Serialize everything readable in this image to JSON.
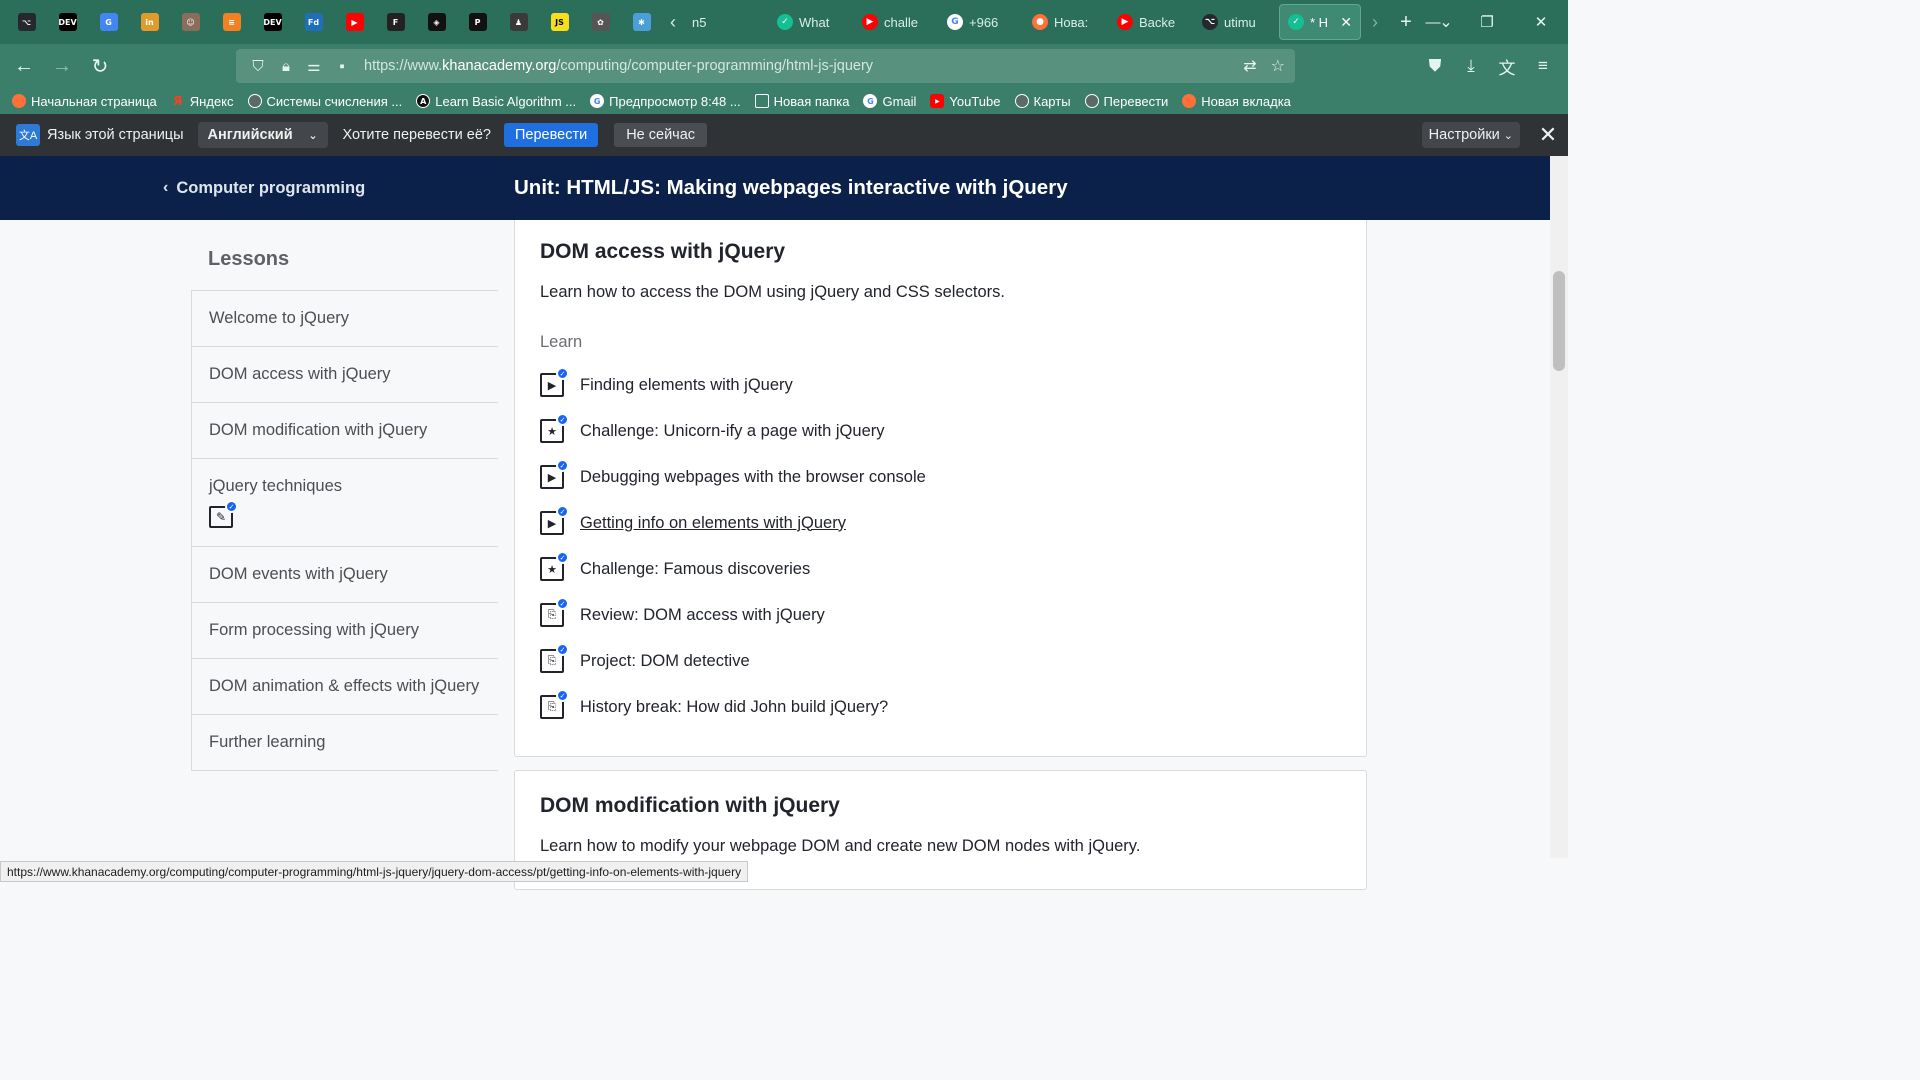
{
  "browser": {
    "pinned_tabs": [
      {
        "icon": "github-icon",
        "color": "#24292e",
        "glyph": "⌥"
      },
      {
        "icon": "dev-icon",
        "color": "#000000",
        "glyph": "DEV"
      },
      {
        "icon": "translate-icon",
        "color": "#4285f4",
        "glyph": "G"
      },
      {
        "icon": "in-icon",
        "color": "#e09b2d",
        "glyph": "in"
      },
      {
        "icon": "avatar-icon",
        "color": "#8a6d5b",
        "glyph": "☺"
      },
      {
        "icon": "stack-icon",
        "color": "#f48024",
        "glyph": "≡"
      },
      {
        "icon": "dev-icon",
        "color": "#000000",
        "glyph": "DEV"
      },
      {
        "icon": "fd-icon",
        "color": "#1d6fb8",
        "glyph": "Fd"
      },
      {
        "icon": "youtube-icon",
        "color": "#ff0000",
        "glyph": "▶"
      },
      {
        "icon": "figma-icon",
        "color": "#222222",
        "glyph": "F"
      },
      {
        "icon": "codepen-icon",
        "color": "#111111",
        "glyph": "◈"
      },
      {
        "icon": "p-icon",
        "color": "#111111",
        "glyph": "P"
      },
      {
        "icon": "person-icon",
        "color": "#3a3a3a",
        "glyph": "♟"
      },
      {
        "icon": "js-icon",
        "color": "#f7df1e",
        "glyph": "JS"
      },
      {
        "icon": "gear-app-icon",
        "color": "#555555",
        "glyph": "✿"
      },
      {
        "icon": "star-app-icon",
        "color": "#4a9fd8",
        "glyph": "✱"
      }
    ],
    "tabs": [
      {
        "label": "n5",
        "fav_color": "",
        "glyph": ""
      },
      {
        "label": "What",
        "fav_color": "#14bf96",
        "glyph": "✓"
      },
      {
        "label": "challe",
        "fav_color": "#ff0000",
        "glyph": "▶"
      },
      {
        "label": "+966",
        "fav_color": "#ffffff",
        "glyph": "G"
      },
      {
        "label": "Нова:",
        "fav_color": "#ff7139",
        "glyph": "●"
      },
      {
        "label": "Backe",
        "fav_color": "#ff0000",
        "glyph": "▶"
      },
      {
        "label": "utimu",
        "fav_color": "#24292e",
        "glyph": "⌥"
      },
      {
        "label": "* H",
        "fav_color": "#14bf96",
        "glyph": "✓"
      }
    ],
    "url_prefix": "https://www.",
    "url_domain": "khanacademy.org",
    "url_path": "/computing/computer-programming/html-js-jquery",
    "bookmarks": [
      {
        "label": "Начальная страница",
        "icon": "firefox-icon",
        "color": "#ff7139"
      },
      {
        "label": "Яндекс",
        "icon": "yandex-icon",
        "color": "#fc3f1d"
      },
      {
        "label": "Системы счисления ...",
        "icon": "globe-icon",
        "color": "#5a6b66"
      },
      {
        "label": "Learn Basic Algorithm ...",
        "icon": "a-icon",
        "color": "#111111"
      },
      {
        "label": "Предпросмотр  8:48 ...",
        "icon": "google-icon",
        "color": "#ffffff"
      },
      {
        "label": "Новая папка",
        "icon": "folder-icon",
        "color": "#3b7f6a"
      },
      {
        "label": "Gmail",
        "icon": "google-icon",
        "color": "#ffffff"
      },
      {
        "label": "YouTube",
        "icon": "youtube-icon",
        "color": "#ff0000"
      },
      {
        "label": "Карты",
        "icon": "globe-icon",
        "color": "#5a6b66"
      },
      {
        "label": "Перевести",
        "icon": "globe-icon",
        "color": "#5a6b66"
      },
      {
        "label": "Новая вкладка",
        "icon": "firefox-icon",
        "color": "#ff7139"
      }
    ]
  },
  "translate": {
    "label": "Язык этой страницы",
    "language": "Английский",
    "question": "Хотите перевести её?",
    "translate_btn": "Перевести",
    "not_now_btn": "Не сейчас",
    "settings_btn": "Настройки"
  },
  "header": {
    "back_label": "Computer programming",
    "unit_title": "Unit: HTML/JS: Making webpages interactive with jQuery"
  },
  "sidebar": {
    "title": "Lessons",
    "lessons": [
      "Welcome to jQuery",
      "DOM access with jQuery",
      "DOM modification with jQuery",
      "jQuery techniques",
      "DOM events with jQuery",
      "Form processing with jQuery",
      "DOM animation & effects with jQuery",
      "Further learning"
    ]
  },
  "section1": {
    "title": "DOM access with jQuery",
    "description": "Learn how to access the DOM using jQuery and CSS selectors.",
    "learn_label": "Learn",
    "items": [
      {
        "label": "Finding elements with jQuery",
        "type": "video"
      },
      {
        "label": "Challenge: Unicorn-ify a page with jQuery",
        "type": "challenge"
      },
      {
        "label": "Debugging webpages with the browser console",
        "type": "video"
      },
      {
        "label": "Getting info on elements with jQuery",
        "type": "video"
      },
      {
        "label": "Challenge: Famous discoveries",
        "type": "challenge"
      },
      {
        "label": "Review: DOM access with jQuery",
        "type": "article"
      },
      {
        "label": "Project: DOM detective",
        "type": "article"
      },
      {
        "label": "History break: How did John build jQuery?",
        "type": "article"
      }
    ]
  },
  "section2": {
    "title": "DOM modification with jQuery",
    "description": "Learn how to modify your webpage DOM and create new DOM nodes with jQuery."
  },
  "status_url": "https://www.khanacademy.org/computing/computer-programming/html-js-jquery/jquery-dom-access/pt/getting-info-on-elements-with-jquery"
}
